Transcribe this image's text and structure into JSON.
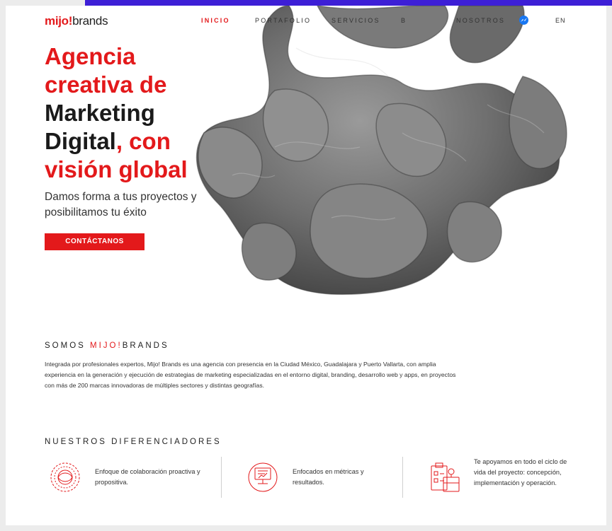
{
  "header": {
    "logo": {
      "prefix": "mijo!",
      "suffix": "brands"
    },
    "nav": [
      "INICIO",
      "PORTAFOLIO",
      "SERVICIOS",
      "B",
      "NOSOTROS"
    ],
    "language": "EN"
  },
  "hero": {
    "headline": {
      "line1": "Agencia",
      "line2": "creativa de",
      "line3": "Marketing",
      "line4_dark": "Digital",
      "line4_red": ", con",
      "line5": "visión global"
    },
    "subtitle": "Damos forma a tus proyectos y posibilitamos tu éxito",
    "cta_label": "CONTÁCTANOS"
  },
  "about": {
    "title_prefix": "SOMOS ",
    "title_highlight": "MIJO!",
    "title_suffix": "BRANDS",
    "body": "Integrada por profesionales expertos, Mijo! Brands es una agencia con presencia en la Ciudad México, Guadalajara y Puerto Vallarta, con amplia experiencia en la generación y ejecución de estrategias de marketing especializadas en el entorno digital, branding, desarrollo web y apps, en proyectos con más de 200 marcas innovadoras de múltiples sectores y distintas geografías."
  },
  "differentiators": {
    "title": "NUESTROS DIFERENCIADORES",
    "items": [
      {
        "text": "Enfoque de colaboración proactiva y propositiva.",
        "icon": "collaboration-circle-icon"
      },
      {
        "text": "Enfocados en métricas y resultados.",
        "icon": "metrics-monitor-icon"
      },
      {
        "text": "Te apoyamos en todo el ciclo de vida del proyecto: concepción, implementación y operación.",
        "icon": "project-lifecycle-icon"
      }
    ]
  },
  "colors": {
    "brand_red": "#e3191b",
    "accent_bar": "#3d1fd6",
    "messenger_blue": "#1877f2"
  }
}
